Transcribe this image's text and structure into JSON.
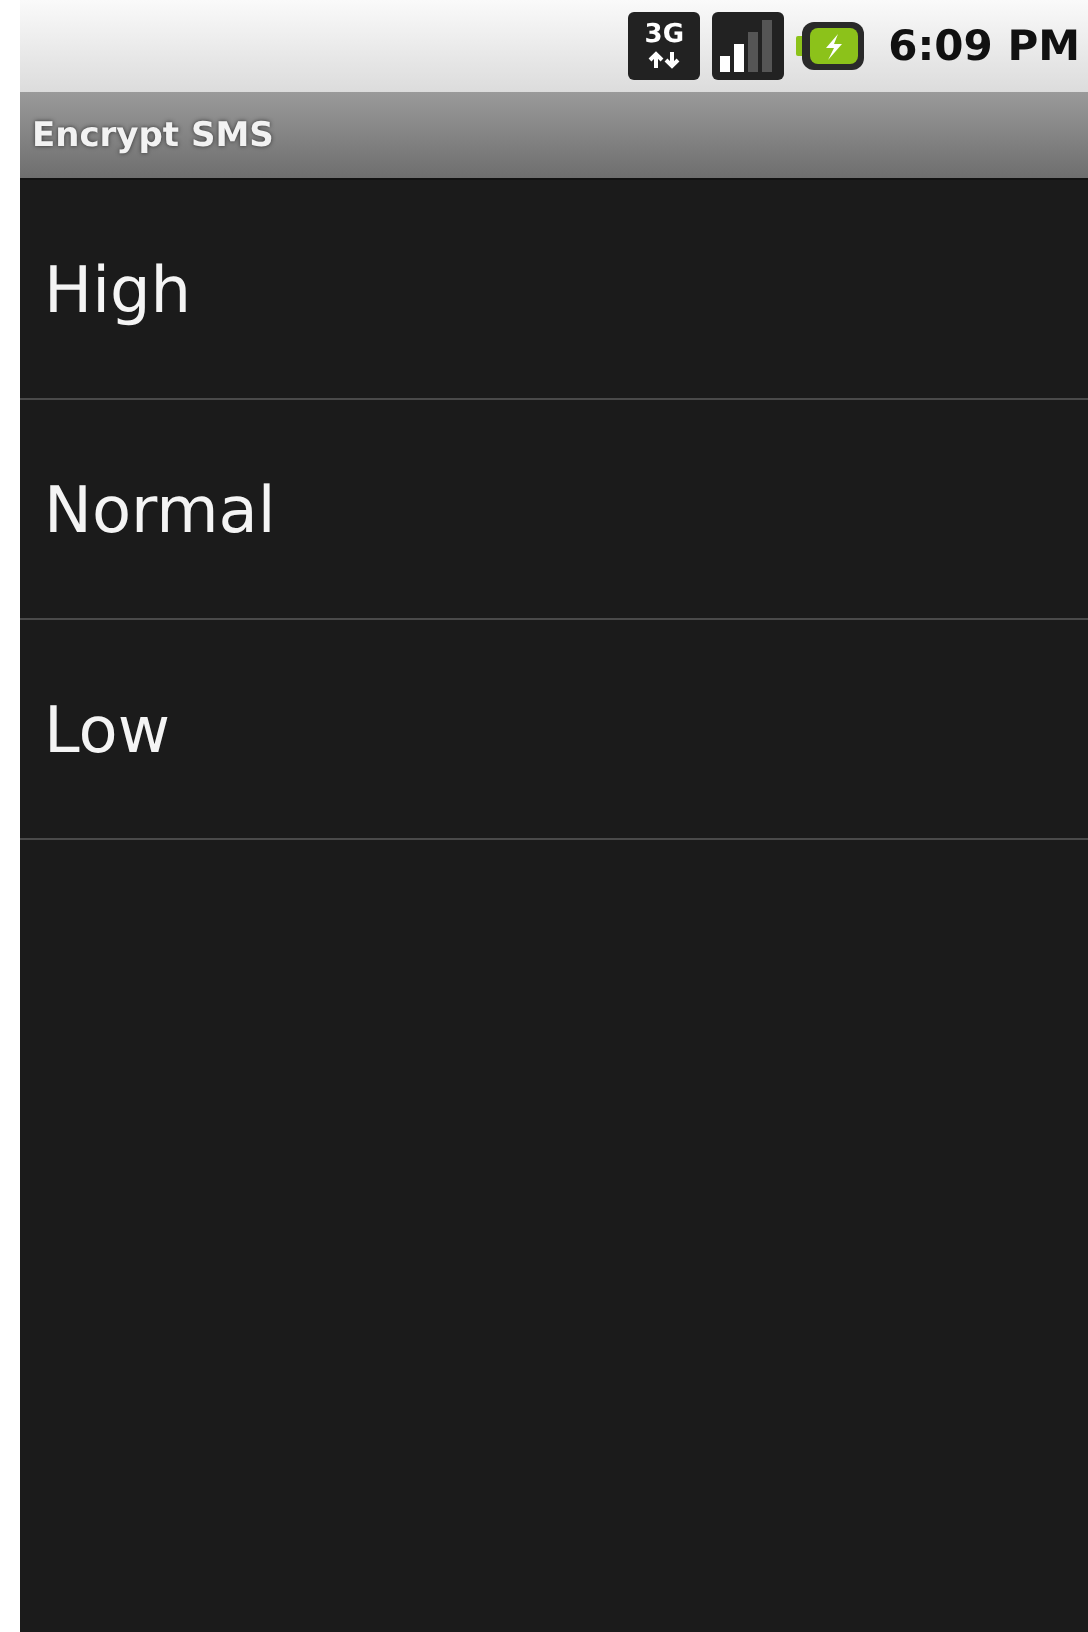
{
  "status_bar": {
    "network_type": "3G",
    "time": "6:09 PM"
  },
  "title_bar": {
    "title": "Encrypt SMS"
  },
  "list": {
    "items": [
      {
        "label": "High"
      },
      {
        "label": "Normal"
      },
      {
        "label": "Low"
      }
    ]
  }
}
